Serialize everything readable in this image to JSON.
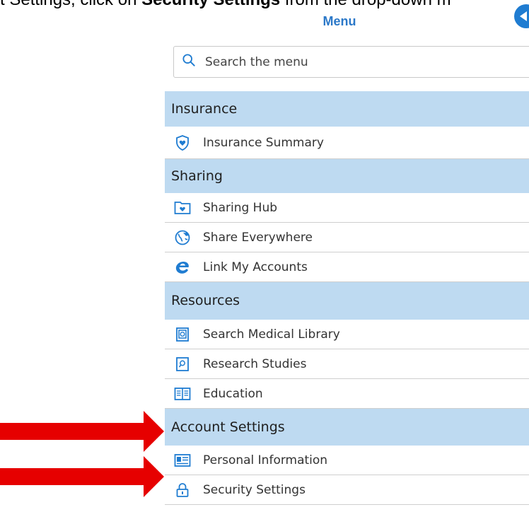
{
  "instruction": {
    "prefix": "t Settings, click on ",
    "bold": "Security Settings",
    "suffix": " from the drop-down m"
  },
  "menu": {
    "title": "Menu",
    "search_placeholder": "Search the menu",
    "sections": [
      {
        "header": "Insurance",
        "items": [
          {
            "label": "Insurance Summary",
            "icon": "shield-heart-icon"
          }
        ]
      },
      {
        "header": "Sharing",
        "items": [
          {
            "label": "Sharing Hub",
            "icon": "folder-heart-icon"
          },
          {
            "label": "Share Everywhere",
            "icon": "globe-share-icon"
          },
          {
            "label": "Link My Accounts",
            "icon": "e-link-icon"
          }
        ]
      },
      {
        "header": "Resources",
        "items": [
          {
            "label": "Search Medical Library",
            "icon": "library-book-icon"
          },
          {
            "label": "Research Studies",
            "icon": "research-book-icon"
          },
          {
            "label": "Education",
            "icon": "open-book-icon"
          }
        ]
      },
      {
        "header": "Account Settings",
        "items": [
          {
            "label": "Personal Information",
            "icon": "id-card-icon"
          },
          {
            "label": "Security Settings",
            "icon": "lock-icon"
          }
        ]
      }
    ]
  },
  "colors": {
    "header_bg": "#bedaf1",
    "accent": "#1f7cd1",
    "arrow": "#e60000"
  }
}
